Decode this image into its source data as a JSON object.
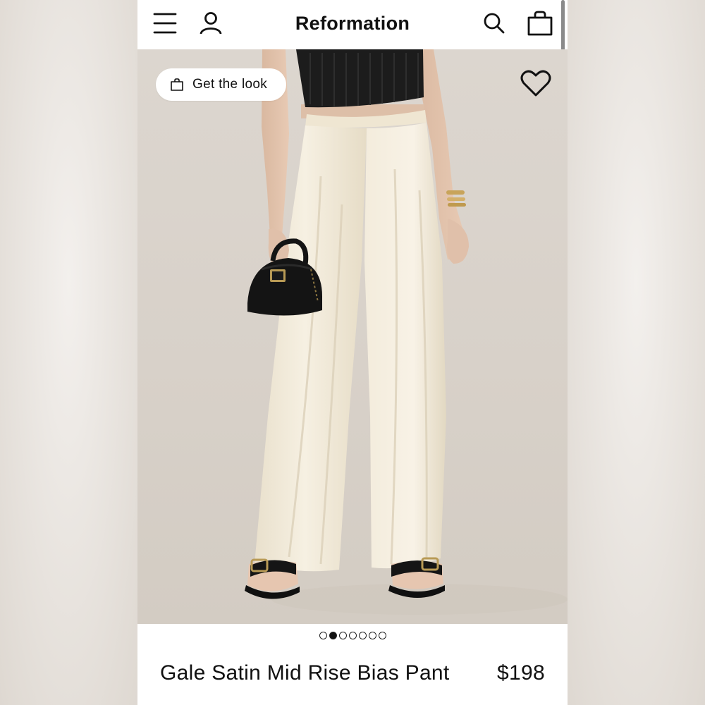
{
  "header": {
    "brand": "Reformation",
    "menu_icon": "hamburger-menu-icon",
    "account_icon": "user-icon",
    "search_icon": "search-icon",
    "bag_icon": "shopping-bag-icon"
  },
  "hero": {
    "get_the_look_label": "Get the look",
    "get_the_look_icon": "shopping-bag-icon",
    "wishlist_icon": "heart-icon",
    "image_subject": "model wearing cream satin wide-leg pants with black top, black handbag and black sandals"
  },
  "carousel": {
    "total_slides": 7,
    "active_index": 1
  },
  "product": {
    "name": "Gale Satin Mid Rise Bias Pant",
    "price": "$198"
  },
  "colors": {
    "text": "#111111",
    "background": "#ffffff",
    "hero_backdrop": "#d9d3cc",
    "pants": "#f1ead9"
  }
}
